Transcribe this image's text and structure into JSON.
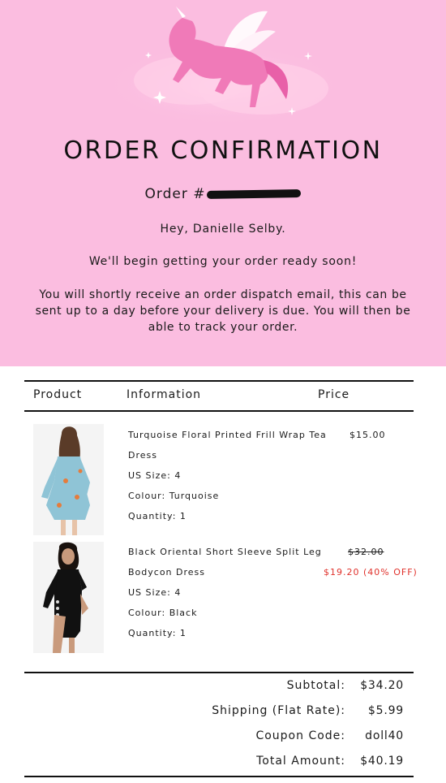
{
  "header": {
    "title": "ORDER CONFIRMATION",
    "order_label": "Order #",
    "greeting": "Hey, Danielle Selby.",
    "ready_message": "We'll begin getting your order ready soon!",
    "dispatch_message": "You will shortly receive an order dispatch email, this can be sent up to a day before your delivery is due. You will then be able to track your order."
  },
  "table": {
    "headers": {
      "product": "Product",
      "information": "Information",
      "price": "Price"
    }
  },
  "items": [
    {
      "name_line1": "Turquoise Floral Printed Frill Wrap Tea",
      "name_line2": "Dress",
      "size": "US Size: 4",
      "colour": "Colour: Turquoise",
      "quantity": "Quantity: 1",
      "price": "$15.00"
    },
    {
      "name_line1": "Black Oriental Short Sleeve Split Leg",
      "name_line2": "Bodycon Dress",
      "size": "US Size: 4",
      "colour": "Colour: Black",
      "quantity": "Quantity: 1",
      "original_price": "$32.00",
      "sale_price": "$19.20 (40% OFF)"
    }
  ],
  "totals": {
    "subtotal_label": "Subtotal:",
    "subtotal": "$34.20",
    "shipping_label": "Shipping (Flat Rate):",
    "shipping": "$5.99",
    "coupon_label": "Coupon Code:",
    "coupon": "doll40",
    "total_label": "Total Amount:",
    "total": "$40.19"
  },
  "colors": {
    "hero_bg": "#fbbde0",
    "sale": "#e0312b",
    "text": "#1a1a1a"
  },
  "icons": {
    "hero_image": "unicorn-illustration"
  }
}
